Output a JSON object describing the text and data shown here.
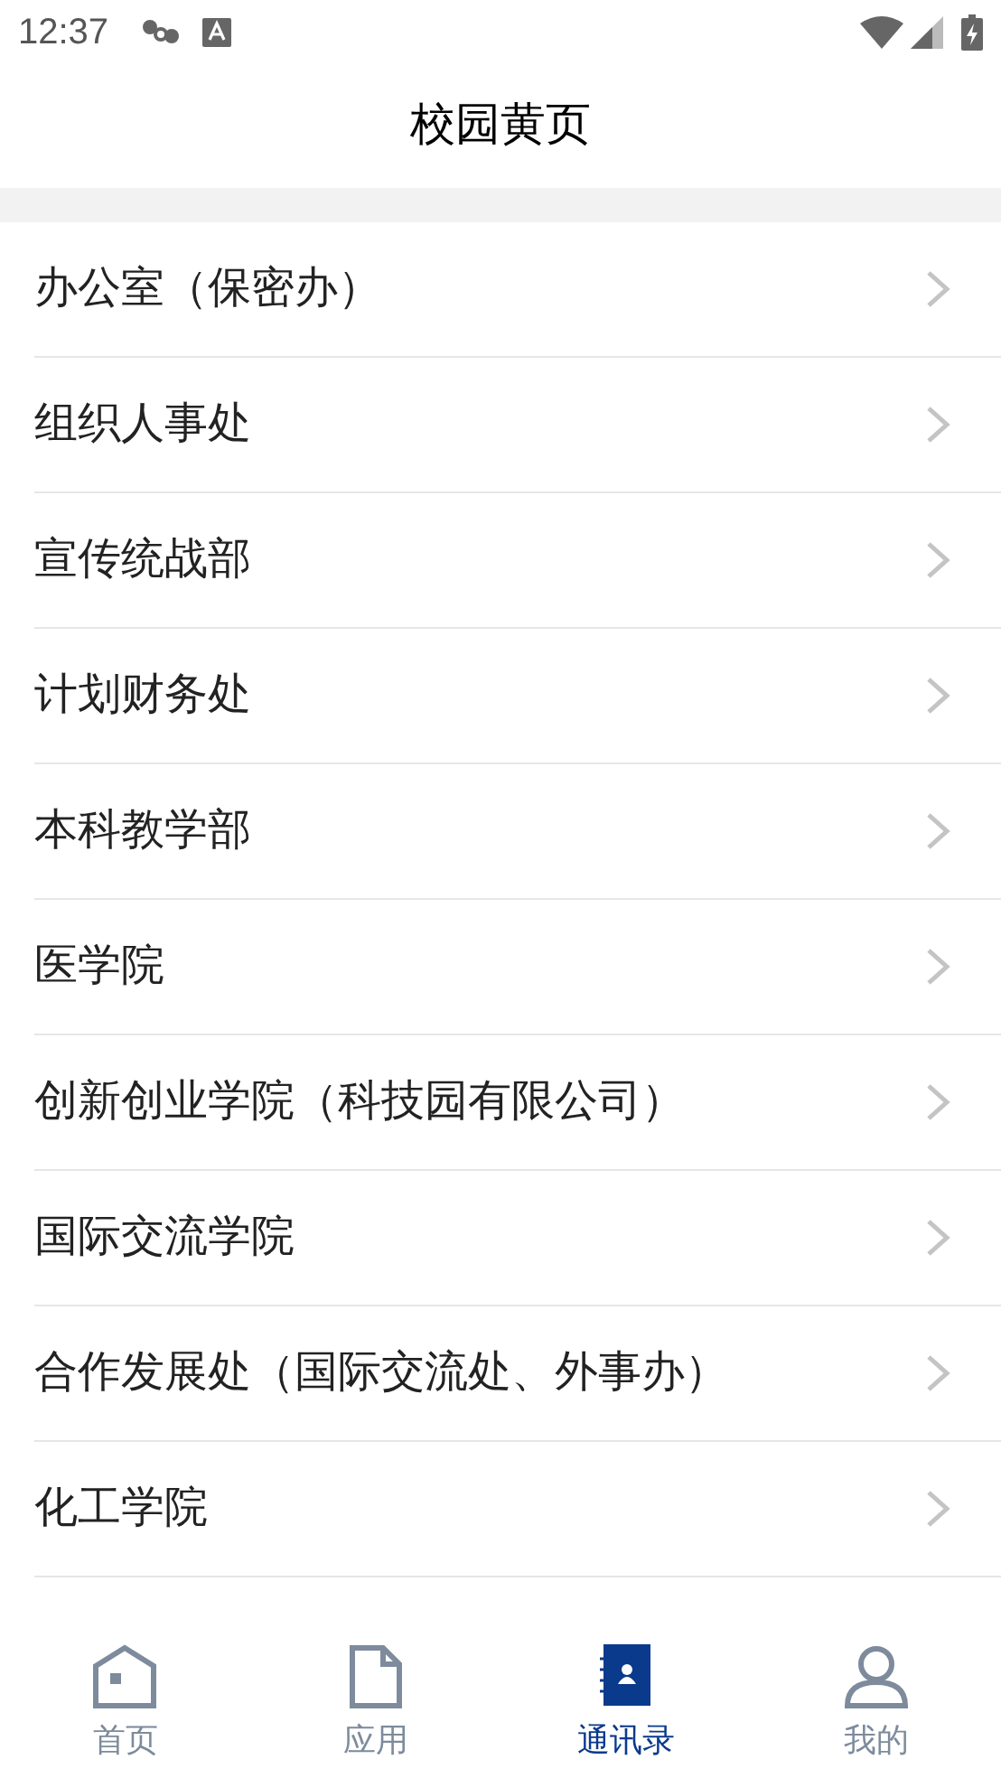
{
  "status_bar": {
    "time": "12:37"
  },
  "header": {
    "title": "校园黄页"
  },
  "list": [
    {
      "label": "办公室（保密办）"
    },
    {
      "label": "组织人事处"
    },
    {
      "label": "宣传统战部"
    },
    {
      "label": "计划财务处"
    },
    {
      "label": "本科教学部"
    },
    {
      "label": "医学院"
    },
    {
      "label": "创新创业学院（科技园有限公司）"
    },
    {
      "label": "国际交流学院"
    },
    {
      "label": "合作发展处（国际交流处、外事办）"
    },
    {
      "label": "化工学院"
    }
  ],
  "tab_bar": [
    {
      "label": "首页",
      "kind": "home",
      "selected": false
    },
    {
      "label": "应用",
      "kind": "apps",
      "selected": false
    },
    {
      "label": "通讯录",
      "kind": "contacts",
      "selected": true
    },
    {
      "label": "我的",
      "kind": "profile",
      "selected": false
    }
  ]
}
